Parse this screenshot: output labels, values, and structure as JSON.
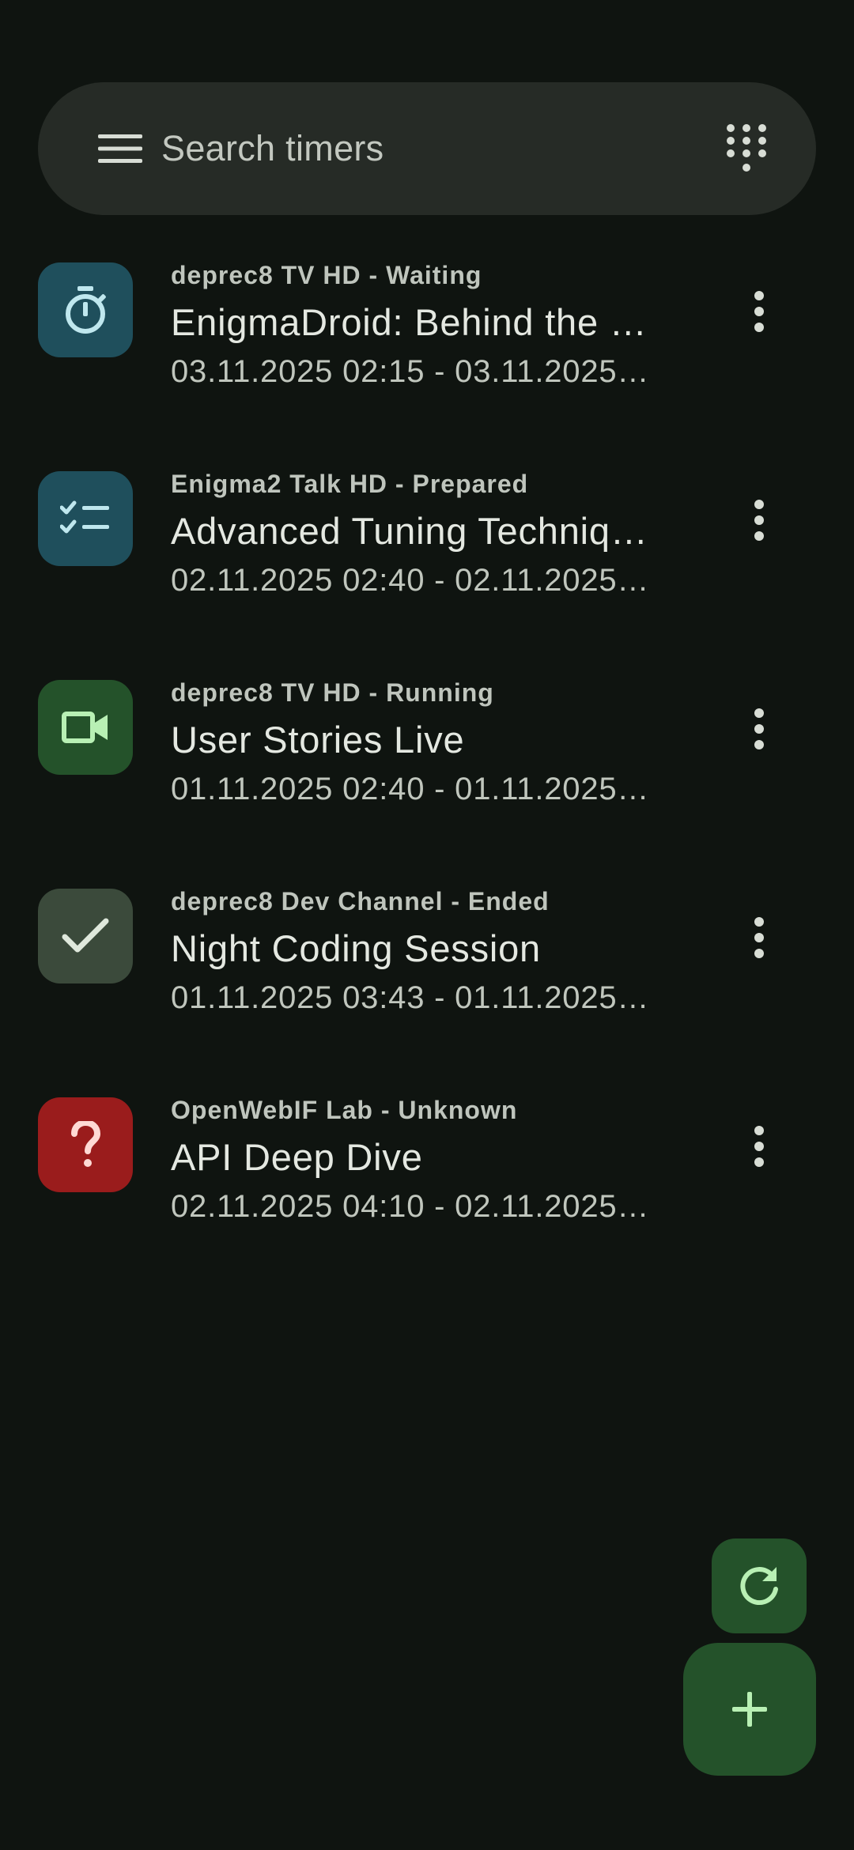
{
  "search": {
    "placeholder": "Search timers",
    "menu_icon": "menu-icon",
    "dialpad_icon": "dialpad-icon"
  },
  "timers": [
    {
      "subtitle": "deprec8 TV HD - Waiting",
      "title": "EnigmaDroid: Behind the …",
      "time": "03.11.2025 02:15 - 03.11.2025…",
      "status": "waiting",
      "icon": "timer-icon",
      "color": "#1f4f5c",
      "icon_color": "#bfe7ee"
    },
    {
      "subtitle": "Enigma2 Talk HD - Prepared",
      "title": "Advanced Tuning Techniq…",
      "time": "02.11.2025 02:40 - 02.11.2025…",
      "status": "prepared",
      "icon": "checklist-icon",
      "color": "#1f4f5c",
      "icon_color": "#bfe7ee"
    },
    {
      "subtitle": "deprec8 TV HD - Running",
      "title": "User Stories Live",
      "time": "01.11.2025 02:40 - 01.11.2025…",
      "status": "running",
      "icon": "videocam-icon",
      "color": "#24522a",
      "icon_color": "#b8f0b4"
    },
    {
      "subtitle": "deprec8 Dev Channel - Ended",
      "title": "Night Coding Session",
      "time": "01.11.2025 03:43 - 01.11.2025…",
      "status": "ended",
      "icon": "check-icon",
      "color": "#3b4a3b",
      "icon_color": "#dfe8dc"
    },
    {
      "subtitle": "OpenWebIF Lab - Unknown",
      "title": "API Deep Dive",
      "time": "02.11.2025 04:10 - 02.11.2025…",
      "status": "unknown",
      "icon": "question-mark-icon",
      "color": "#9a1c1c",
      "icon_color": "#ffd9d4"
    }
  ],
  "fab": {
    "refresh_icon": "refresh-icon",
    "add_icon": "add-icon",
    "color": "#24522a",
    "icon_color": "#b8f0b4"
  }
}
